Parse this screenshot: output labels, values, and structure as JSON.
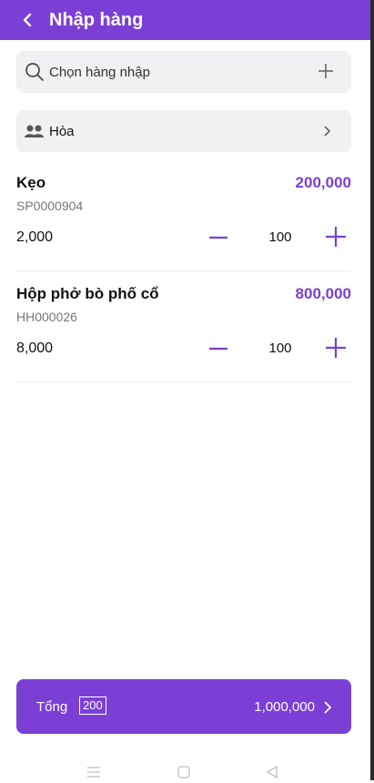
{
  "header": {
    "title": "Nhập hàng"
  },
  "search": {
    "placeholder": "Chọn hàng nhập"
  },
  "supplier": {
    "name": "Hòa"
  },
  "items": [
    {
      "name": "Kẹo",
      "code": "SP0000904",
      "price": "2,000",
      "quantity": "100",
      "total": "200,000"
    },
    {
      "name": "Hộp phở bò phố cổ",
      "code": "HH000026",
      "price": "8,000",
      "quantity": "100",
      "total": "800,000"
    }
  ],
  "summary": {
    "label": "Tổng",
    "count": "200",
    "amount": "1,000,000"
  },
  "colors": {
    "accent": "#7b3fd6",
    "field_bg": "#f1f1f4"
  },
  "icons": [
    "back-arrow-icon",
    "search-icon",
    "plus-icon",
    "users-icon",
    "chevron-right-icon",
    "minus-icon",
    "menu-icon",
    "home-icon",
    "back-triangle-icon"
  ]
}
